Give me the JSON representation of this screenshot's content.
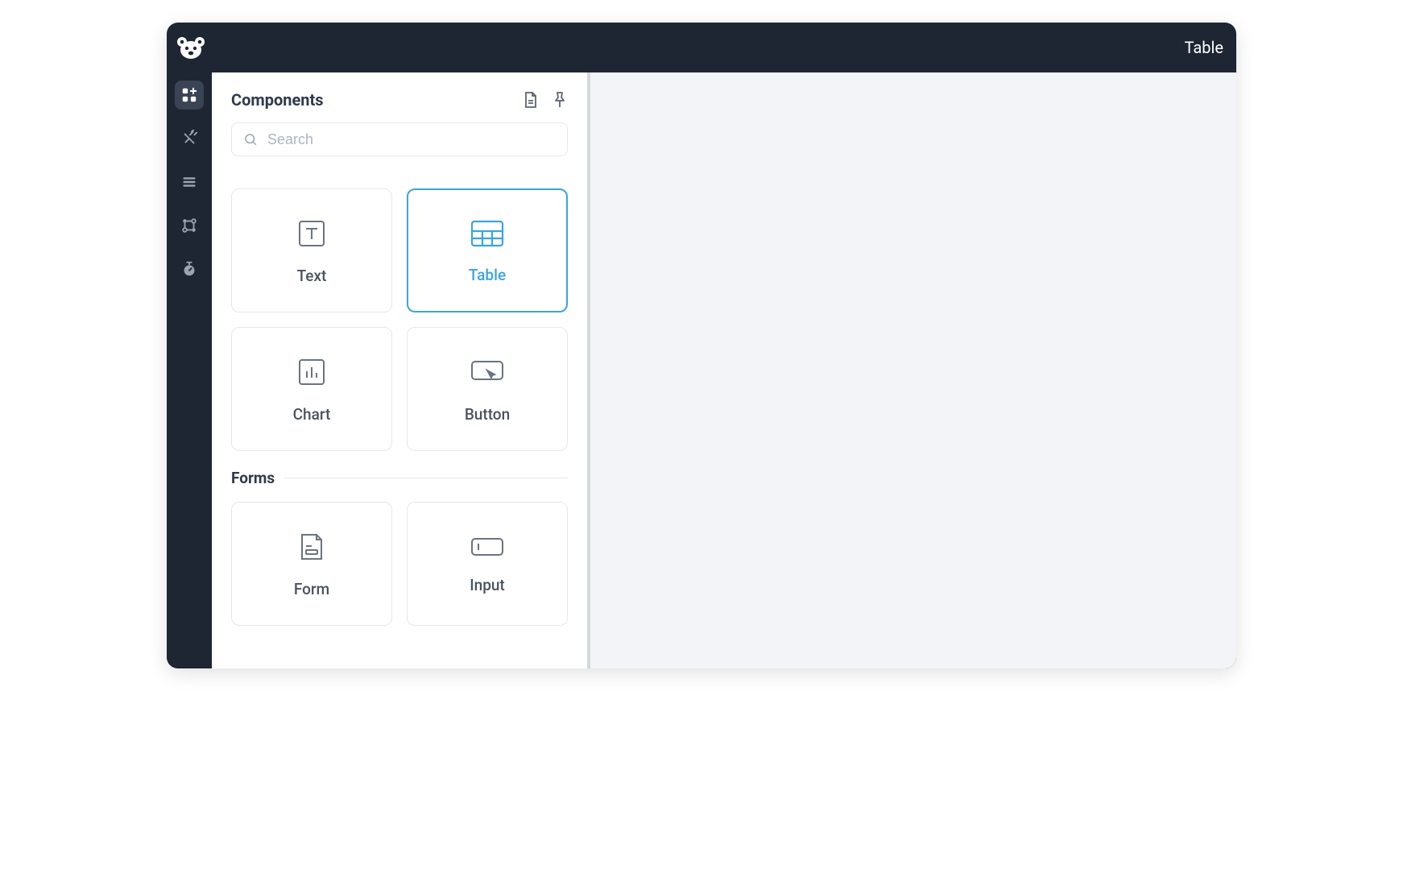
{
  "header": {
    "title": "Table"
  },
  "rail": {
    "items": [
      {
        "name": "components",
        "active": true
      },
      {
        "name": "integrations",
        "active": false
      },
      {
        "name": "list",
        "active": false
      },
      {
        "name": "workflow",
        "active": false
      },
      {
        "name": "timer",
        "active": false
      }
    ]
  },
  "panel": {
    "title": "Components",
    "search": {
      "placeholder": "Search",
      "value": ""
    },
    "sections": [
      {
        "label": "",
        "cards": [
          {
            "label": "Text",
            "icon": "text",
            "selected": false
          },
          {
            "label": "Table",
            "icon": "table",
            "selected": true
          },
          {
            "label": "Chart",
            "icon": "chart",
            "selected": false
          },
          {
            "label": "Button",
            "icon": "button",
            "selected": false
          }
        ]
      },
      {
        "label": "Forms",
        "cards": [
          {
            "label": "Form",
            "icon": "form",
            "selected": false
          },
          {
            "label": "Input",
            "icon": "input",
            "selected": false
          }
        ]
      }
    ]
  }
}
